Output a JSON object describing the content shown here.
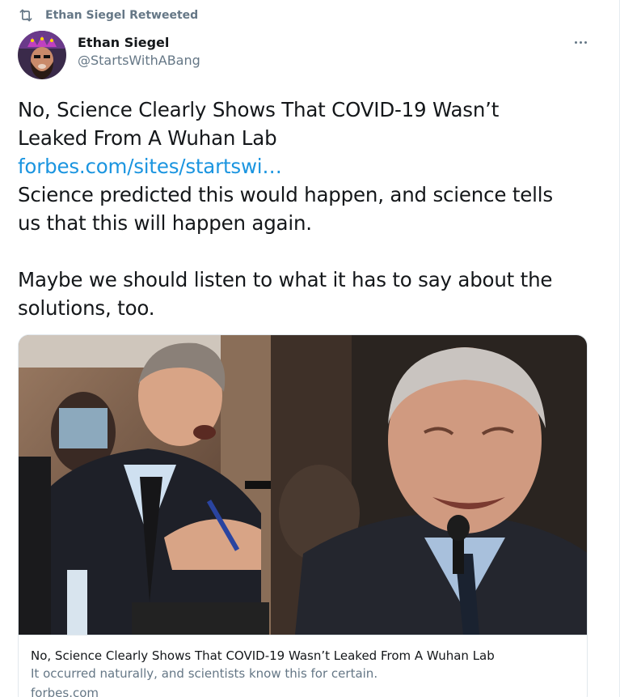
{
  "retweet": {
    "label": "Ethan Siegel Retweeted",
    "icon": "retweet-icon"
  },
  "author": {
    "display_name": "Ethan Siegel",
    "handle": "@StartsWithABang",
    "avatar": "avatar-photo"
  },
  "more": {
    "icon": "more-options-icon"
  },
  "tweet": {
    "line1": "No, Science Clearly Shows That COVID-19 Wasn’t",
    "line2": "Leaked From A Wuhan Lab",
    "link": "forbes.com/sites/startswi…",
    "line3": "Science predicted this would happen, and science tells",
    "line4": "us that this will happen again.",
    "line5": "Maybe we should listen to what it has to say about the",
    "line6": "solutions, too."
  },
  "card": {
    "title": "No, Science Clearly Shows That COVID-19 Wasn’t Leaked From A Wuhan Lab",
    "description": "It occurred naturally, and scientists know this for certain.",
    "domain": "forbes.com"
  },
  "colors": {
    "link": "#1b95e0",
    "secondary_text": "#657786",
    "primary_text": "#14171a",
    "border": "#e1e8ed"
  }
}
